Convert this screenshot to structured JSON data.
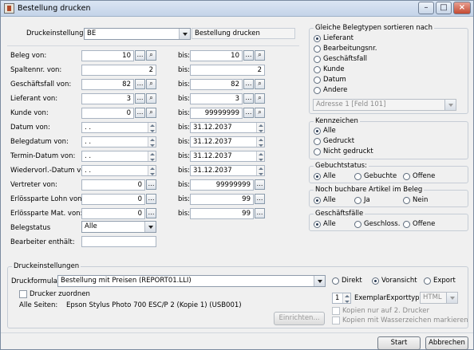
{
  "window": {
    "title": "Bestellung drucken"
  },
  "print_settings": {
    "label": "Druckeinstellungen:",
    "value": "BE",
    "name": "Bestellung drucken"
  },
  "von_bis": {
    "bis": "bis:"
  },
  "rows": [
    {
      "label": "Beleg von:",
      "from": "10",
      "to": "10"
    },
    {
      "label": "Spaltennr. von:",
      "from": "2",
      "to": "2"
    },
    {
      "label": "Geschäftsfall von:",
      "from": "82",
      "to": "82"
    },
    {
      "label": "Lieferant von:",
      "from": "3",
      "to": "3"
    },
    {
      "label": "Kunde von:",
      "from": "0",
      "to": "99999999"
    },
    {
      "label": "Datum von:",
      "from": ". .",
      "to": "31.12.2037"
    },
    {
      "label": "Belegdatum von:",
      "from": ". .",
      "to": "31.12.2037"
    },
    {
      "label": "Termin-Datum von:",
      "from": ". .",
      "to": "31.12.2037"
    },
    {
      "label": "Wiedervorl.-Datum von:",
      "from": ". .",
      "to": "31.12.2037"
    },
    {
      "label": "Vertreter von:",
      "from": "0",
      "to": "99999999"
    },
    {
      "label": "Erlössparte Lohn von:",
      "from": "0",
      "to": "99"
    },
    {
      "label": "Erlössparte Mat. von:",
      "from": "0",
      "to": "99"
    }
  ],
  "belegstatus": {
    "label": "Belegstatus",
    "value": "Alle"
  },
  "bearbeiter": {
    "label": "Bearbeiter enthält:",
    "value": ""
  },
  "sort": {
    "title": "Gleiche Belegtypen sortieren nach",
    "options": [
      "Lieferant",
      "Bearbeitungsnr.",
      "Geschäftsfall",
      "Kunde",
      "Datum",
      "Andere"
    ],
    "selected": "Lieferant",
    "address_value": "Adresse 1 [Feld 101]"
  },
  "kennzeichen": {
    "title": "Kennzeichen",
    "options": [
      "Alle",
      "Gedruckt",
      "Nicht gedruckt"
    ],
    "selected": "Alle"
  },
  "gebucht": {
    "title": "Gebuchtstatus:",
    "options": [
      "Alle",
      "Gebuchte",
      "Offene"
    ],
    "selected": "Alle"
  },
  "buchbar": {
    "title": "Noch buchbare Artikel im Beleg",
    "options": [
      "Alle",
      "Ja",
      "Nein"
    ],
    "selected": "Alle"
  },
  "faelle": {
    "title": "Geschäftsfälle",
    "options": [
      "Alle",
      "Geschloss.",
      "Offene"
    ],
    "selected": "Alle"
  },
  "druck": {
    "title": "Druckeinstellungen",
    "form_label": "Druckformular:",
    "form_value": "Bestellung mit Preisen (REPORT01.LLI)",
    "outputs": [
      "Direkt",
      "Voransicht",
      "Export"
    ],
    "output_selected": "Voransicht",
    "printer_assign": "Drucker zuordnen",
    "all_pages_label": "Alle Seiten:",
    "printer_name": "Epson Stylus Photo 700 ESC/P 2 (Kopie 1) (USB001)",
    "setup_button": "Einrichten...",
    "copies": "1",
    "copies_label": "Exemplar",
    "export_type_label": "Exporttyp:",
    "export_type": "HTML",
    "copy_second_only": "Kopien nur auf 2. Drucker",
    "copy_watermark": "Kopien mit Wasserzeichen markieren"
  },
  "buttons": {
    "start": "Start",
    "cancel": "Abbrechen"
  },
  "icons": {
    "lookup": "ellipsis-icon",
    "search": "search-icon"
  }
}
